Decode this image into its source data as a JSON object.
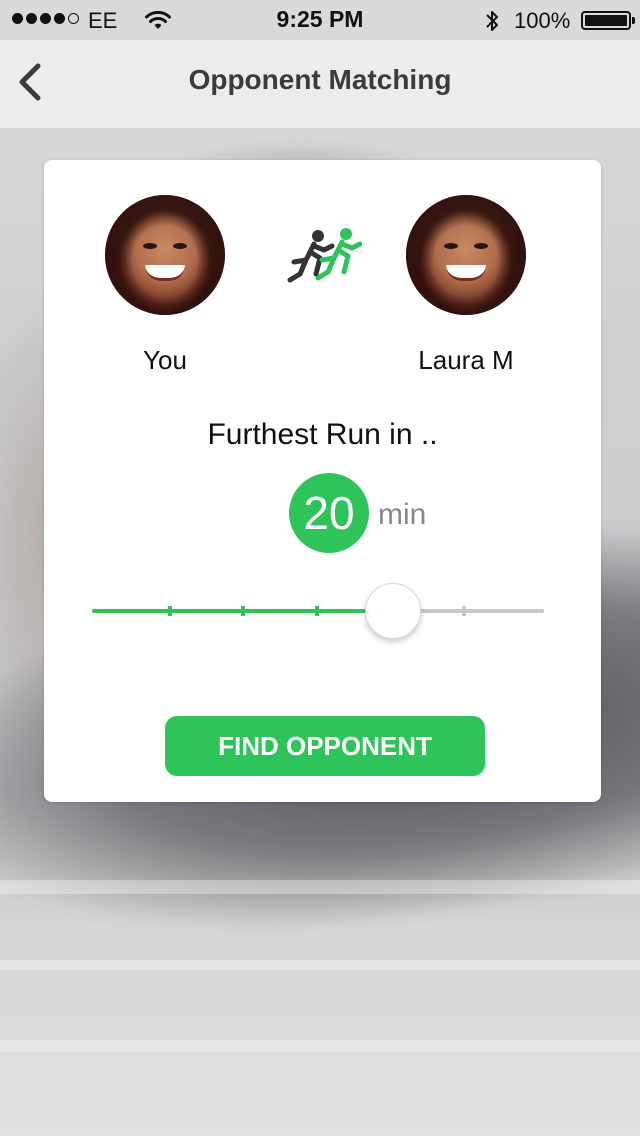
{
  "status_bar": {
    "carrier": "EE",
    "time": "9:25 PM",
    "battery_percent": "100%",
    "signal_bars_filled": 4,
    "signal_bars_total": 5
  },
  "nav": {
    "title": "Opponent Matching",
    "back_icon": "chevron-left-icon"
  },
  "players": {
    "you": {
      "name": "You"
    },
    "opponent": {
      "name": "Laura M"
    },
    "versus_icon": "runners-icon"
  },
  "challenge": {
    "prompt": "Furthest Run in ..",
    "duration_value": "20",
    "duration_unit": "min"
  },
  "slider": {
    "steps": 7,
    "selected_index": 4
  },
  "actions": {
    "find_label": "FIND OPPONENT"
  },
  "colors": {
    "accent": "#2ec45a",
    "track_inactive": "#c8c8c8",
    "title_text": "#3b3b3b"
  }
}
